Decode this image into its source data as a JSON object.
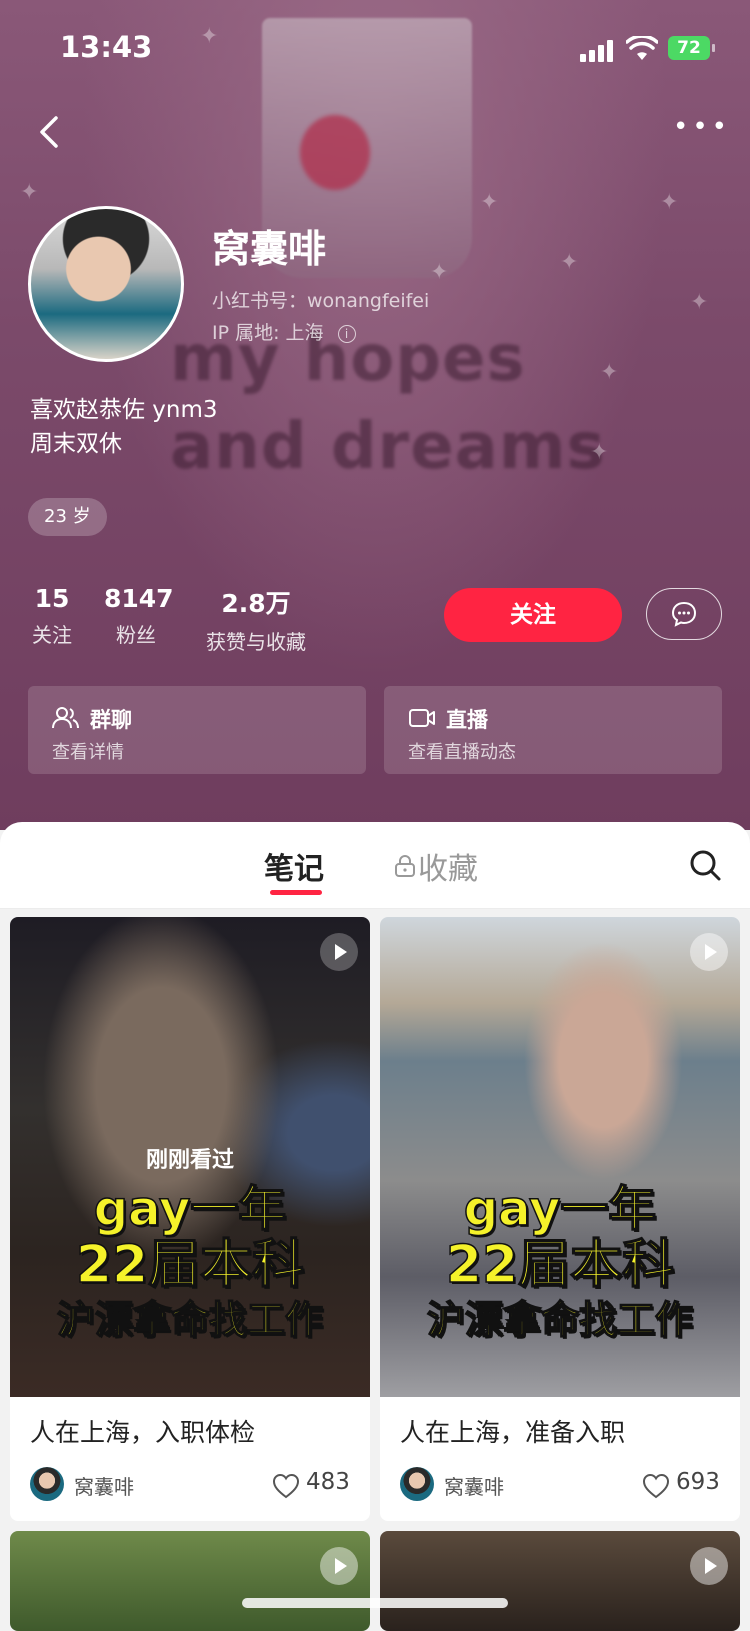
{
  "status_bar": {
    "time": "13:43",
    "battery": "72"
  },
  "hero": {
    "image_text_line1": "my hopes",
    "image_text_line2": "and dreams"
  },
  "profile": {
    "name": "窝囊啡",
    "red_id": "小红书号：wonangfeifei",
    "ip_location": "IP 属地: 上海",
    "bio_line1": "喜欢赵恭佐 ynm3",
    "bio_line2": "周末双休",
    "age_tag": "23 岁"
  },
  "stats": [
    {
      "value": "15",
      "label": "关注"
    },
    {
      "value": "8147",
      "label": "粉丝"
    },
    {
      "value": "2.8万",
      "label": "获赞与收藏"
    }
  ],
  "actions": {
    "follow_label": "关注"
  },
  "cards": [
    {
      "title": "群聊",
      "subtitle": "查看详情"
    },
    {
      "title": "直播",
      "subtitle": "查看直播动态"
    }
  ],
  "tabs": [
    {
      "label": "笔记",
      "active": true
    },
    {
      "label": "收藏",
      "active": false,
      "locked": true
    }
  ],
  "notes": [
    {
      "badge": "刚刚看过",
      "overlay_line1": "gay一年",
      "overlay_line2": "22届本科",
      "overlay_line3": "沪漂拿命找工作",
      "title": "人在上海，入职体检",
      "author": "窝囊啡",
      "likes": "483"
    },
    {
      "overlay_line1": "gay一年",
      "overlay_line2": "22届本科",
      "overlay_line3": "沪漂拿命找工作",
      "title": "人在上海，准备入职",
      "author": "窝囊啡",
      "likes": "693"
    }
  ],
  "colors": {
    "accent": "#ff2442",
    "hero_bg": "#7b4a6a",
    "overlay_text": "#f5f22a"
  }
}
